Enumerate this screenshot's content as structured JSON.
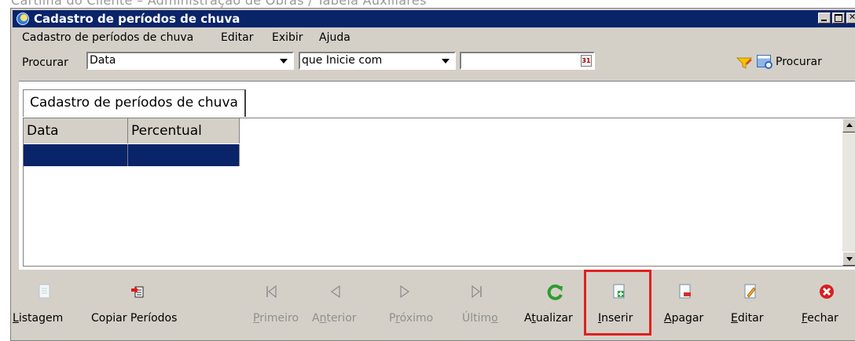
{
  "document_header": "Cartilha do Cliente – Administração de Obras / Tabela Auxiliares",
  "window": {
    "title": "Cadastro de períodos de chuva",
    "buttons": [
      "minimize",
      "maximize",
      "close"
    ]
  },
  "menubar": {
    "items": [
      "Cadastro de períodos de chuva",
      "Editar",
      "Exibir",
      "Ajuda"
    ]
  },
  "search": {
    "label": "Procurar",
    "field_value": "Data",
    "condition_value": "que Inicie com",
    "search_value": "",
    "calendar_glyph": "31",
    "button_label": "Procurar"
  },
  "tabs": [
    {
      "label": "Cadastro de períodos de chuva",
      "active": true
    }
  ],
  "grid": {
    "columns": [
      "Data",
      "Percentual"
    ],
    "rows": [
      {
        "selected": true,
        "cells": [
          "",
          ""
        ]
      }
    ]
  },
  "toolbar": {
    "buttons": [
      {
        "label": "Listagem",
        "accel": "L",
        "rest": "istagem",
        "enabled": true,
        "icon": "document-list-icon"
      },
      {
        "label": "Copiar Períodos",
        "accel": "",
        "rest": "Copiar Períodos",
        "enabled": true,
        "icon": "copy-periods-icon"
      },
      {
        "label": "Primeiro",
        "accel": "P",
        "rest": "rimeiro",
        "enabled": false,
        "icon": "first-record-icon"
      },
      {
        "label": "Anterior",
        "accel": "n",
        "pre": "A",
        "rest": "terior",
        "enabled": false,
        "icon": "previous-record-icon"
      },
      {
        "label": "Próximo",
        "accel": "r",
        "pre": "P",
        "rest": "óximo",
        "enabled": false,
        "icon": "next-record-icon"
      },
      {
        "label": "Último",
        "accel": "o",
        "pre": "Últim",
        "rest": "",
        "enabled": false,
        "icon": "last-record-icon"
      },
      {
        "label": "Atualizar",
        "accel": "t",
        "pre": "A",
        "rest": "ualizar",
        "enabled": true,
        "icon": "refresh-icon"
      },
      {
        "label": "Inserir",
        "accel": "I",
        "rest": "nserir",
        "enabled": true,
        "icon": "insert-icon",
        "highlighted": true
      },
      {
        "label": "Apagar",
        "accel": "A",
        "rest": "pagar",
        "enabled": true,
        "icon": "delete-icon"
      },
      {
        "label": "Editar",
        "accel": "E",
        "rest": "ditar",
        "enabled": true,
        "icon": "edit-icon"
      },
      {
        "label": "Fechar",
        "accel": "F",
        "rest": "echar",
        "enabled": true,
        "icon": "close-red-icon"
      }
    ]
  },
  "colors": {
    "title_bar": "#0a246a",
    "window_bg": "#d4d0c8",
    "selection": "#0a246a",
    "highlight_box": "#e02020",
    "disabled_text": "#8f8f8f",
    "refresh_green": "#2e9c2e",
    "close_red": "#d62020"
  }
}
